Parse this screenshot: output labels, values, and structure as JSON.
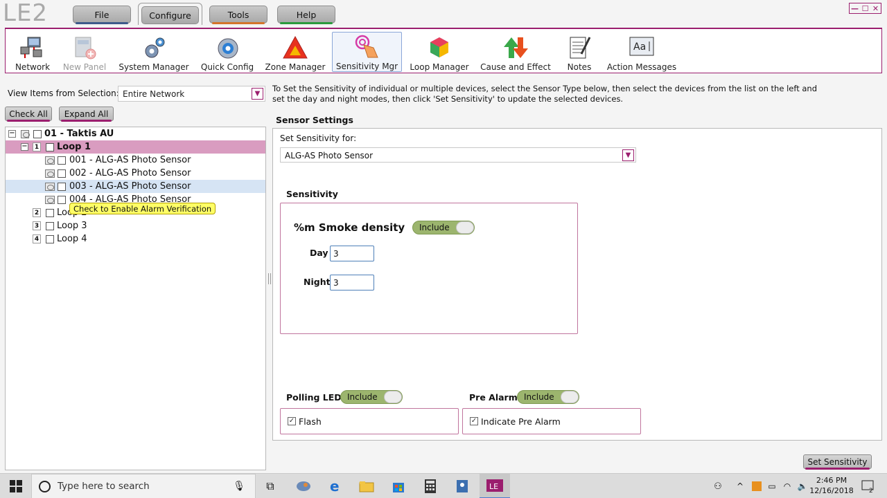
{
  "app": {
    "logo": "LE2",
    "window_controls": {
      "minimize": "—",
      "maximize": "☐",
      "close": "✕"
    }
  },
  "menu": {
    "items": [
      {
        "label": "File",
        "underline": "#3c5a8a"
      },
      {
        "label": "Configure",
        "underline": "#9b1e6e"
      },
      {
        "label": "Tools",
        "underline": "#d4732a"
      },
      {
        "label": "Help",
        "underline": "#2a9a3c"
      }
    ],
    "active": "Configure"
  },
  "toolbar": {
    "items": [
      {
        "label": "Network",
        "icon": "network-icon"
      },
      {
        "label": "New Panel",
        "icon": "new-panel-icon",
        "disabled": true
      },
      {
        "label": "System Manager",
        "icon": "system-manager-icon"
      },
      {
        "label": "Quick Config",
        "icon": "quick-config-icon"
      },
      {
        "label": "Zone Manager",
        "icon": "zone-manager-icon"
      },
      {
        "label": "Sensitivity Mgr",
        "icon": "sensitivity-icon",
        "selected": true
      },
      {
        "label": "Loop Manager",
        "icon": "loop-manager-icon"
      },
      {
        "label": "Cause and Effect",
        "icon": "cause-effect-icon"
      },
      {
        "label": "Notes",
        "icon": "notes-icon"
      },
      {
        "label": "Action Messages",
        "icon": "action-messages-icon"
      }
    ]
  },
  "view": {
    "label": "View Items from Selection:",
    "selected": "Entire Network",
    "dropdown_glyph": "▼"
  },
  "info_text": "To Set the Sensitivity of individual or multiple devices, select the Sensor Type below, then select the devices from the list on the left and set the day and night modes, then click 'Set Sensitivity' to update the selected devices.",
  "buttons": {
    "check_all": "Check All",
    "expand_all": "Expand All",
    "set_sensitivity": "Set Sensitivity"
  },
  "tree": {
    "panel": {
      "label": "01 - Taktis AU"
    },
    "loops": [
      {
        "num": "1",
        "label": "Loop 1",
        "expanded": true
      },
      {
        "num": "2",
        "label": "Loop 2"
      },
      {
        "num": "3",
        "label": "Loop 3"
      },
      {
        "num": "4",
        "label": "Loop 4"
      }
    ],
    "devices": [
      "001 - ALG-AS Photo Sensor",
      "002 - ALG-AS Photo Sensor",
      "003 - ALG-AS Photo Sensor",
      "004 - ALG-AS Photo Sensor"
    ],
    "collapse_glyph": "−"
  },
  "tooltip": "Check to Enable Alarm Verification",
  "sensor_settings": {
    "title": "Sensor Settings",
    "set_for_label": "Set Sensitivity for:",
    "sensor_type": "ALG-AS Photo Sensor",
    "sensitivity_label": "Sensitivity",
    "smoke_label": "%m Smoke density",
    "include_label": "Include",
    "day_label": "Day",
    "day_value": "3",
    "night_label": "Night",
    "night_value": "3",
    "polling_led_label": "Polling LED",
    "flash_label": "Flash",
    "flash_checked": true,
    "pre_alarm_label": "Pre Alarm",
    "indicate_pre_alarm_label": "Indicate Pre Alarm",
    "indicate_pre_alarm_checked": true,
    "check_glyph": "✓"
  },
  "taskbar": {
    "search_placeholder": "Type here to search",
    "time": "2:46 PM",
    "date": "12/16/2018",
    "notifications": "2"
  },
  "colors": {
    "accent": "#9b1e6e",
    "loop_highlight": "#d99cc0",
    "toggle_green": "#9cb56e"
  }
}
